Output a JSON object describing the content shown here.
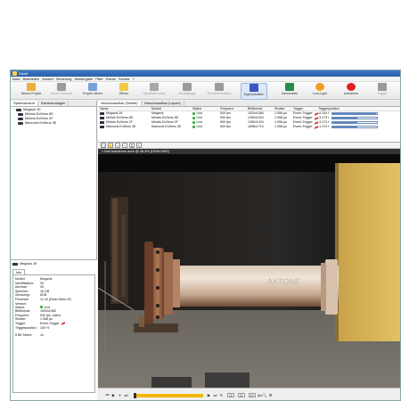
{
  "window": {
    "title": "Visart"
  },
  "menu": [
    "Datei",
    "Bearbeiten",
    "Ansicht",
    "Steuerung",
    "Wiedergabe",
    "Filter",
    "Extras",
    "Fenster",
    "?"
  ],
  "toolbar": [
    {
      "label": "Neues Projekt",
      "icon": "new-project-icon",
      "color": "#e8b23a",
      "enabled": true
    },
    {
      "label": "Neuer Versuch",
      "icon": "new-test-icon",
      "color": "#9a9a9a",
      "enabled": false
    },
    {
      "label": "Projekt öffnen",
      "icon": "open-project-icon",
      "color": "#7aa0d8",
      "enabled": true
    },
    {
      "label": "Öffnen",
      "icon": "open-folder-icon",
      "color": "#f1c84a",
      "enabled": true
    },
    {
      "label": "Speichern unter",
      "icon": "save-as-icon",
      "color": "#a8a8a8",
      "enabled": false
    },
    {
      "label": "Rückgängig",
      "icon": "undo-icon",
      "color": "#9a9a9a",
      "enabled": false
    },
    {
      "label": "Wiederherstellen",
      "icon": "redo-icon",
      "color": "#9a9a9a",
      "enabled": false
    },
    {
      "label": "Eigenschaften",
      "icon": "properties-icon",
      "color": "#3b57c4",
      "enabled": true,
      "selected": true
    },
    {
      "label": "Kamerabild",
      "icon": "camera-image-icon",
      "color": "#2a8a4a",
      "enabled": true
    },
    {
      "label": "Low-Light",
      "icon": "low-light-icon",
      "color": "#f0a020",
      "enabled": true
    },
    {
      "label": "Aufnahme",
      "icon": "record-icon",
      "color": "#dd2222",
      "enabled": true
    },
    {
      "label": "Trigger",
      "icon": "trigger-icon",
      "color": "#999999",
      "enabled": false
    }
  ],
  "left_tabs": [
    "Systemansicht",
    "Kameravorlagen"
  ],
  "tree": {
    "root": "Megavis 39",
    "children": [
      "Minivis EoSens 8D",
      "Minivis EoSens 2F",
      "Macrovis EoSens 3E"
    ]
  },
  "info": {
    "camera": "Megavis 39",
    "tab": "Info",
    "fields1": [
      {
        "k": "Modell:",
        "v": "Megavis"
      },
      {
        "k": "Identifikation:",
        "v": "39"
      },
      {
        "k": "Adresse:",
        "v": "39"
      },
      {
        "k": "Speicher:",
        "v": "16 GB"
      },
      {
        "k": "Sensortyp:",
        "v": "8GB"
      },
      {
        "k": "Firmware Version:",
        "v": "11.15 (Zmax Main uF)"
      }
    ],
    "fields2": [
      {
        "k": "Status:",
        "v": "Live",
        "status": true
      },
      {
        "k": "Bildformat:",
        "v": "1920x1080"
      },
      {
        "k": "Frequenz:",
        "v": "500 fps, Intern"
      },
      {
        "k": "Shutter:",
        "v": "1.958 µs"
      },
      {
        "k": "Trigger:",
        "v": "Event-Trigger",
        "trigger": true
      },
      {
        "k": "Triggerposition:",
        "v": "100 %"
      }
    ],
    "fields3": [
      {
        "k": "8 Bit Select:",
        "v": "1k"
      }
    ]
  },
  "right_tabs": [
    "Versuchsaufbau (Tabelle)",
    "Versuchsaufbau (Layout)"
  ],
  "table": {
    "headers": [
      "Name",
      "Modell",
      "Status",
      "Frequenz",
      "Bildformat",
      "Shutter",
      "Trigger",
      "Triggerposition"
    ],
    "rows": [
      {
        "name": "Megavis 39",
        "model": "Megavis",
        "status": "Live",
        "freq": "500 fps",
        "format": "1920x1080",
        "shutter": "1.958 µs",
        "trigger": "Event-Trigger",
        "pos": "-6.154 f",
        "fill": 0.98
      },
      {
        "name": "Minivis EoSens 8D",
        "model": "Minivis EoSens 8D",
        "status": "Live",
        "freq": "500 fps",
        "format": "1280x1024",
        "shutter": "1.958 µs",
        "trigger": "Event-Trigger",
        "pos": "-3.273 f",
        "fill": 0.55
      },
      {
        "name": "Minivis EoSens 2F",
        "model": "Minivis EoSens 2F",
        "status": "Live",
        "freq": "500 fps",
        "format": "1280x1024",
        "shutter": "1.958 µs",
        "trigger": "Event-Trigger",
        "pos": "-3.273 f",
        "fill": 0.55
      },
      {
        "name": "Macrovis EoSens 3E",
        "model": "Macrovis EoSens 3E",
        "status": "Live",
        "freq": "500 fps",
        "format": "1696x1710",
        "shutter": "1.958 µs",
        "trigger": "Event-Trigger",
        "pos": "-1.472 f",
        "fill": 0.55
      }
    ]
  },
  "video": {
    "title": "Ball Aufnahme.avov @ 48,3% [1920x1080]",
    "brand": "AXTONE"
  },
  "playbar": {
    "field1": "10",
    "field2": "20",
    "field3": "6.0",
    "unit": "fps",
    "progress": 1.0
  },
  "colors": {
    "live": "#22b022",
    "accent": "#3a78c8"
  }
}
